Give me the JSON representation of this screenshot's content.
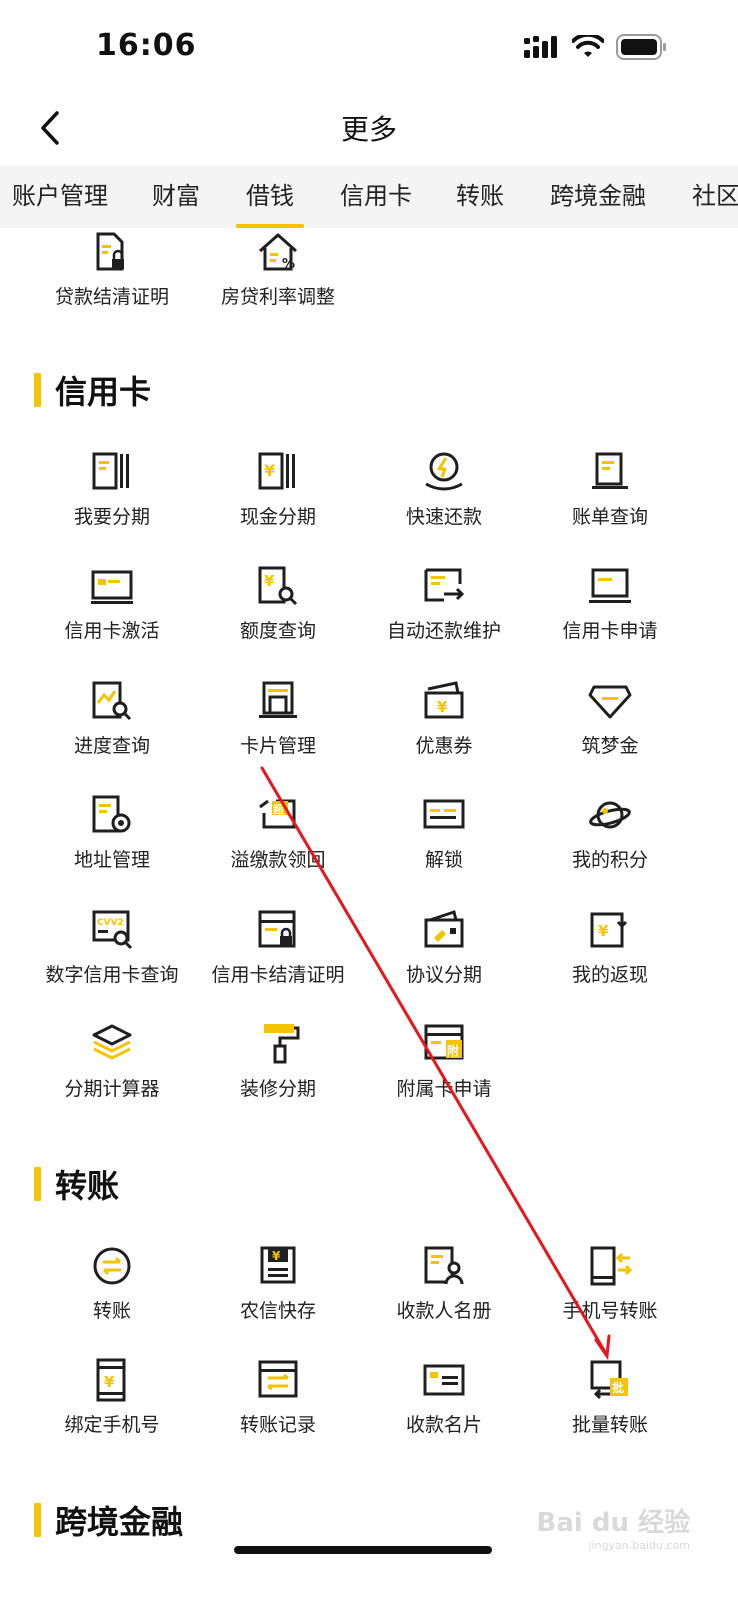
{
  "status_bar": {
    "time": "16:06"
  },
  "nav": {
    "title": "更多"
  },
  "tabs": [
    {
      "label": "账户管理",
      "active": false
    },
    {
      "label": "财富",
      "active": false
    },
    {
      "label": "借钱",
      "active": true
    },
    {
      "label": "信用卡",
      "active": false
    },
    {
      "label": "转账",
      "active": false
    },
    {
      "label": "跨境金融",
      "active": false
    },
    {
      "label": "社区",
      "active": false
    }
  ],
  "loan_section": {
    "items": [
      {
        "label": "贷款结清证明",
        "icon": "document-lock-icon"
      },
      {
        "label": "房贷利率调整",
        "icon": "house-percent-icon"
      }
    ]
  },
  "credit_card_section": {
    "title": "信用卡",
    "items": [
      {
        "label": "我要分期",
        "icon": "installment-icon"
      },
      {
        "label": "现金分期",
        "icon": "cash-installment-icon"
      },
      {
        "label": "快速还款",
        "icon": "quick-repay-icon"
      },
      {
        "label": "账单查询",
        "icon": "bill-query-icon"
      },
      {
        "label": "信用卡激活",
        "icon": "card-activate-icon"
      },
      {
        "label": "额度查询",
        "icon": "limit-query-icon"
      },
      {
        "label": "自动还款维护",
        "icon": "auto-repay-icon"
      },
      {
        "label": "信用卡申请",
        "icon": "card-apply-icon"
      },
      {
        "label": "进度查询",
        "icon": "progress-query-icon"
      },
      {
        "label": "卡片管理",
        "icon": "card-manage-icon"
      },
      {
        "label": "优惠券",
        "icon": "coupon-icon"
      },
      {
        "label": "筑梦金",
        "icon": "diamond-icon"
      },
      {
        "label": "地址管理",
        "icon": "address-gear-icon"
      },
      {
        "label": "溢缴款领回",
        "icon": "overpay-icon"
      },
      {
        "label": "解锁",
        "icon": "unlock-card-icon"
      },
      {
        "label": "我的积分",
        "icon": "planet-icon"
      },
      {
        "label": "数字信用卡查询",
        "icon": "cvv2-query-icon"
      },
      {
        "label": "信用卡结清证明",
        "icon": "card-settle-icon"
      },
      {
        "label": "协议分期",
        "icon": "agreement-installment-icon"
      },
      {
        "label": "我的返现",
        "icon": "cashback-icon"
      },
      {
        "label": "分期计算器",
        "icon": "layers-icon"
      },
      {
        "label": "装修分期",
        "icon": "paint-roller-icon"
      },
      {
        "label": "附属卡申请",
        "icon": "supplementary-card-icon"
      }
    ]
  },
  "transfer_section": {
    "title": "转账",
    "items": [
      {
        "label": "转账",
        "icon": "transfer-circle-icon"
      },
      {
        "label": "农信快存",
        "icon": "quick-deposit-icon"
      },
      {
        "label": "收款人名册",
        "icon": "payee-list-icon"
      },
      {
        "label": "手机号转账",
        "icon": "phone-transfer-icon"
      },
      {
        "label": "绑定手机号",
        "icon": "bind-phone-icon"
      },
      {
        "label": "转账记录",
        "icon": "transfer-record-icon"
      },
      {
        "label": "收款名片",
        "icon": "payment-card-icon"
      },
      {
        "label": "批量转账",
        "icon": "batch-transfer-icon"
      }
    ]
  },
  "cross_border_section": {
    "title": "跨境金融"
  },
  "watermark": {
    "text": "Bai du 经验",
    "sub": "jingyan.baidu.com"
  },
  "colors": {
    "accent": "#f5c300",
    "ink": "#1f1f1f",
    "annotation": "#e8141c"
  }
}
